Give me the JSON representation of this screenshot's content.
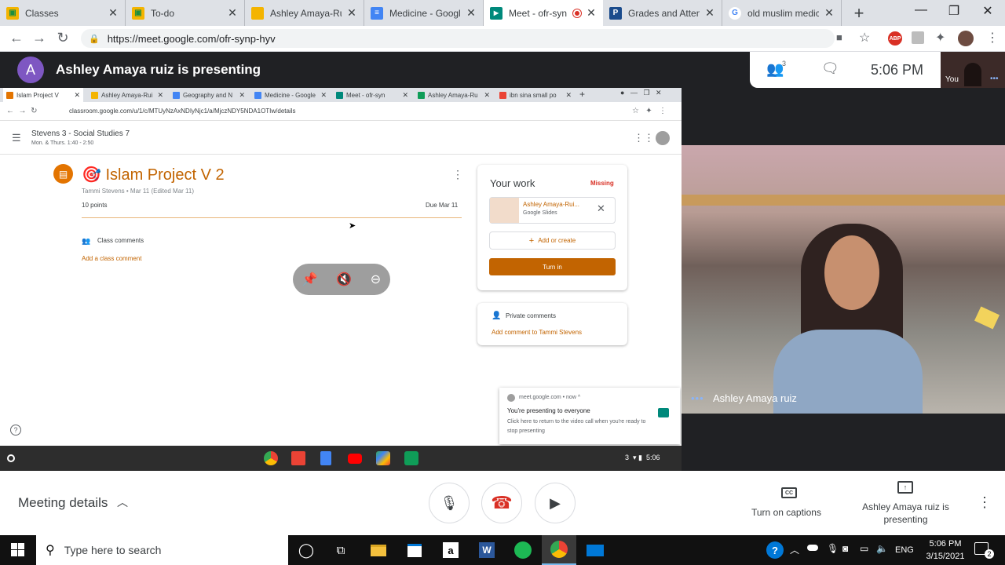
{
  "browser": {
    "tabs": [
      {
        "title": "Classes",
        "icon": "classroom-icon"
      },
      {
        "title": "To-do",
        "icon": "classroom-icon"
      },
      {
        "title": "Ashley Amaya-Rui",
        "icon": "slides-icon"
      },
      {
        "title": "Medicine - Google",
        "icon": "docs-icon"
      },
      {
        "title": "Meet - ofr-syn",
        "icon": "meet-icon",
        "active": true
      },
      {
        "title": "Grades and Attenc",
        "icon": "parentvue-icon"
      },
      {
        "title": "old muslim medici",
        "icon": "google-icon"
      }
    ],
    "url": "https://meet.google.com/ofr-synp-hyv",
    "extension_abp": "ABP"
  },
  "meet": {
    "presenter_initial": "A",
    "presenter_banner": "Ashley Amaya ruiz is presenting",
    "participant_count": "3",
    "time": "5:06 PM",
    "self_label": "You",
    "video_name": "Ashley Amaya ruiz",
    "meeting_details": "Meeting details",
    "captions_label": "Turn on captions",
    "captions_icon_text": "CC",
    "presenting_label": "Ashley Amaya ruiz is presenting"
  },
  "shared": {
    "tabs": [
      {
        "title": "Islam Project V",
        "color": "#e37400"
      },
      {
        "title": "Ashley Amaya-Rui",
        "color": "#f4b400"
      },
      {
        "title": "Geography and N",
        "color": "#4285f4"
      },
      {
        "title": "Medicine - Google",
        "color": "#4285f4"
      },
      {
        "title": "Meet - ofr-syn",
        "color": "#00897b"
      },
      {
        "title": "Ashley Amaya-Ru",
        "color": "#0f9d58"
      },
      {
        "title": "ibn sina small po",
        "color": "#ea4335"
      }
    ],
    "url": "classroom.google.com/u/1/c/MTUyNzAxNDIyNjc1/a/MjczNDY5NDA1OTIw/details",
    "class_name": "Stevens 3 - Social Studies 7",
    "class_schedule": "Mon. & Thurs. 1:40 - 2:50",
    "assignment_title": "Islam Project V 2",
    "assignment_emoji": "🎯",
    "author_line": "Tammi Stevens • Mar 11 (Edited Mar 11)",
    "points": "10 points",
    "due": "Due Mar 11",
    "class_comments": "Class comments",
    "add_class_comment": "Add a class comment",
    "your_work": "Your work",
    "status": "Missing",
    "attachment_name": "Ashley Amaya-Rui...",
    "attachment_type": "Google Slides",
    "add_or_create": "Add or create",
    "turn_in": "Turn in",
    "private_comments": "Private comments",
    "add_private_comment": "Add comment to Tammi Stevens",
    "notif_source": "meet.google.com • now ^",
    "notif_title": "You're presenting to everyone",
    "notif_body": "Click here to return to the video call when you're ready to stop presenting",
    "shelf_badge": "3",
    "shelf_time": "5:06"
  },
  "taskbar": {
    "search_placeholder": "Type here to search",
    "lang": "ENG",
    "time": "5:06 PM",
    "date": "3/15/2021",
    "notif_count": "2"
  },
  "colors": {
    "classroom_orange": "#c26401",
    "missing_red": "#d93025",
    "meet_dark": "#202124",
    "hangup_red": "#d93025"
  }
}
